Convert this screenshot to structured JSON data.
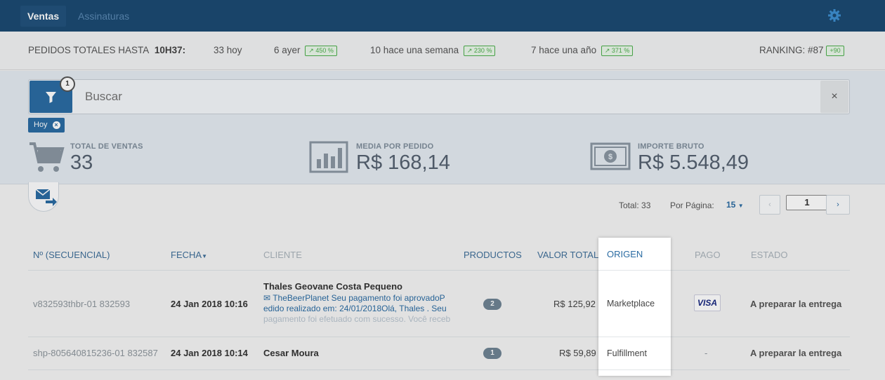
{
  "nav": {
    "tabs": [
      {
        "label": "Ventas",
        "active": true
      },
      {
        "label": "Assinaturas",
        "active": false
      }
    ],
    "settings_icon": "gear-icon"
  },
  "stats": {
    "title": "PEDIDOS TOTALES HASTA",
    "time": "10H37:",
    "today": "33 hoy",
    "yesterday": "6 ayer",
    "yesterday_pct": "450 %",
    "week": "10 hace una semana",
    "week_pct": "230 %",
    "year": "7 hace una año",
    "year_pct": "371 %",
    "ranking": "RANKING: #87",
    "ranking_delta": "+90"
  },
  "filter": {
    "count": "1",
    "search_placeholder": "Buscar",
    "clear_label": "×",
    "chip_label": "Hoy",
    "chip_close": "×"
  },
  "kpis": [
    {
      "label": "TOTAL DE VENTAS",
      "value": "33",
      "icon": "cart-icon"
    },
    {
      "label": "MEDIA POR PEDIDO",
      "value": "R$ 168,14",
      "icon": "bar-chart-icon"
    },
    {
      "label": "IMPORTE BRUTO",
      "value": "R$ 5.548,49",
      "icon": "banknote-icon"
    }
  ],
  "pagination": {
    "total": "Total: 33",
    "per_page_label": "Por Página:",
    "per_page_value": "15",
    "prev": "‹",
    "page": "1",
    "next": "›"
  },
  "table": {
    "headers": {
      "id": "Nº (SECUENCIAL)",
      "date": "FECHA",
      "client": "CLIENTE",
      "products": "PRODUCTOS",
      "total": "VALOR TOTAL",
      "origin": "ORIGEN",
      "paid": "PAGO",
      "status": "ESTADO"
    },
    "rows": [
      {
        "id": "v832593thbr-01 832593",
        "date": "24 Jan 2018 10:16",
        "client": "Thales Geovane Costa Pequeno",
        "message_l1": "TheBeerPlanet Seu pagamento foi aprovadoP",
        "message_l2": "edido realizado em: 24/01/2018Olá, Thales . Seu",
        "message_l3": "pagamento foi efetuado com sucesso. Você receb",
        "products": "2",
        "total": "R$ 125,92",
        "origin": "Marketplace",
        "paid": "VISA",
        "status": "A preparar la entrega"
      },
      {
        "id": "shp-805640815236-01 832587",
        "date": "24 Jan 2018 10:14",
        "client": "Cesar Moura",
        "products": "1",
        "total": "R$ 59,89",
        "origin": "Fulfillment",
        "paid": "-",
        "status": "A preparar la entrega"
      }
    ]
  },
  "colors": {
    "nav_bg": "#1c4a72",
    "accent": "#2b6ca3",
    "badge_green": "#4cae4c"
  }
}
